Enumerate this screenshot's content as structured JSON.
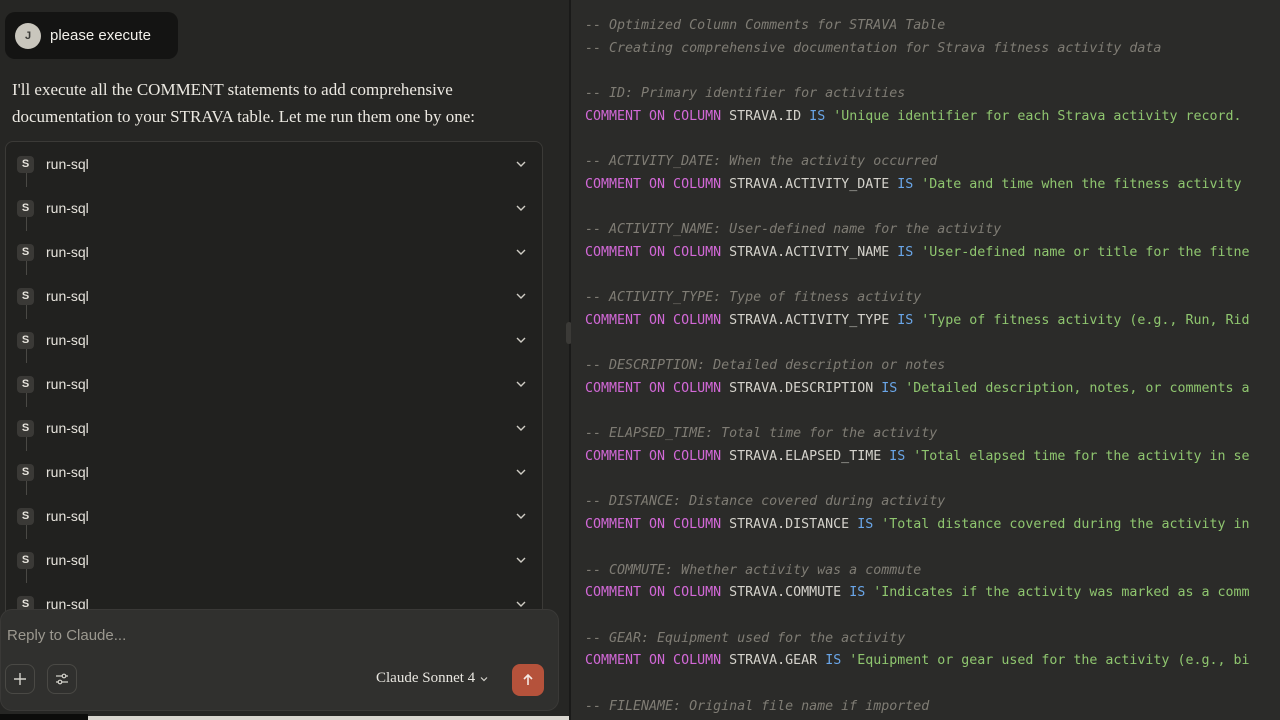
{
  "chat": {
    "user_initial": "J",
    "user_message": "please execute",
    "assistant_message": "I'll execute all the COMMENT statements to add comprehensive documentation to your STRAVA table. Let me run them one by one:",
    "tool_badge": "S",
    "tool_calls": [
      "run-sql",
      "run-sql",
      "run-sql",
      "run-sql",
      "run-sql",
      "run-sql",
      "run-sql",
      "run-sql",
      "run-sql",
      "run-sql",
      "run-sql"
    ]
  },
  "composer": {
    "placeholder": "Reply to Claude...",
    "model": "Claude Sonnet 4",
    "icons": {
      "add": "plus-icon",
      "tools": "sliders-icon",
      "send": "arrow-up-icon",
      "model": "chevron-down-icon"
    }
  },
  "code": {
    "header_comments": [
      "-- Optimized Column Comments for STRAVA Table",
      "-- Creating comprehensive documentation for Strava fitness activity data"
    ],
    "blocks": [
      {
        "comment": "-- ID: Primary identifier for activities",
        "kw": "COMMENT ON COLUMN",
        "col": "STRAVA.ID",
        "is": "IS",
        "str": "'Unique identifier for each Strava activity record. "
      },
      {
        "comment": "-- ACTIVITY_DATE: When the activity occurred",
        "kw": "COMMENT ON COLUMN",
        "col": "STRAVA.ACTIVITY_DATE",
        "is": "IS",
        "str": "'Date and time when the fitness activity "
      },
      {
        "comment": "-- ACTIVITY_NAME: User-defined name for the activity",
        "kw": "COMMENT ON COLUMN",
        "col": "STRAVA.ACTIVITY_NAME",
        "is": "IS",
        "str": "'User-defined name or title for the fitne"
      },
      {
        "comment": "-- ACTIVITY_TYPE: Type of fitness activity",
        "kw": "COMMENT ON COLUMN",
        "col": "STRAVA.ACTIVITY_TYPE",
        "is": "IS",
        "str": "'Type of fitness activity (e.g., Run, Rid"
      },
      {
        "comment": "-- DESCRIPTION: Detailed description or notes",
        "kw": "COMMENT ON COLUMN",
        "col": "STRAVA.DESCRIPTION",
        "is": "IS",
        "str": "'Detailed description, notes, or comments a"
      },
      {
        "comment": "-- ELAPSED_TIME: Total time for the activity",
        "kw": "COMMENT ON COLUMN",
        "col": "STRAVA.ELAPSED_TIME",
        "is": "IS",
        "str": "'Total elapsed time for the activity in se"
      },
      {
        "comment": "-- DISTANCE: Distance covered during activity",
        "kw": "COMMENT ON COLUMN",
        "col": "STRAVA.DISTANCE",
        "is": "IS",
        "str": "'Total distance covered during the activity in"
      },
      {
        "comment": "-- COMMUTE: Whether activity was a commute",
        "kw": "COMMENT ON COLUMN",
        "col": "STRAVA.COMMUTE",
        "is": "IS",
        "str": "'Indicates if the activity was marked as a comm"
      },
      {
        "comment": "-- GEAR: Equipment used for the activity",
        "kw": "COMMENT ON COLUMN",
        "col": "STRAVA.GEAR",
        "is": "IS",
        "str": "'Equipment or gear used for the activity (e.g., bi"
      }
    ],
    "trailing_comment": "-- FILENAME: Original file name if imported"
  }
}
